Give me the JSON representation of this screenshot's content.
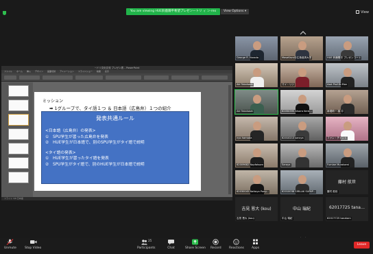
{
  "banner": "You are viewing HUE鈴鹿陽平希望プレゼン一トリ ィ ン-rex",
  "view_options": "View Options ▾",
  "view_label": "View",
  "ppt": {
    "title": "~ドリ文化交流 プレゼン表 – PowerPoint",
    "tabs": [
      "ファイル",
      "ホーム",
      "挿入",
      "デザイン",
      "画面切替",
      "アニメーション",
      "スライドショー",
      "校閲",
      "表示"
    ],
    "status": "スライド 3/8  日本語"
  },
  "slide": {
    "mission": "ミッション",
    "intro": "➡  1グループで、タイ語１つ ＆ 日本語（広島弁）１つの紹介",
    "rule_title": "発表共通ルール",
    "sec1_heading": "<日本語（広島弁）の発表>",
    "sec1_line1": "①　SPU学生が習った広島弁を発表",
    "sec1_line2": "②　HUE学生が日本語で、別のSPU学生がタイ語で説明",
    "sec2_heading": "<タイ語の発表>",
    "sec2_line1": "①　HUE学生が習ったタイ語を発表",
    "sec2_line2": "②　SPU学生がタイ語で、別のHUE学生が日本語で説明"
  },
  "participants": [
    {
      "name": "George R. Harada",
      "big": ""
    },
    {
      "name": "MasaKazu@広島経済大学",
      "big": ""
    },
    {
      "name": "HUE 鈴鹿陽平 プレゼンコート",
      "big": ""
    },
    {
      "name": "Aki Takahashi",
      "big": ""
    },
    {
      "name": "マイ・リジ",
      "big": ""
    },
    {
      "name": "Asst Prof.Dr.Mon",
      "big": ""
    },
    {
      "name": "Aki Takahashi",
      "big": ""
    },
    {
      "name": "62050395 Atsara Kerd…",
      "big": ""
    },
    {
      "name": "新堀莉一 橋 中",
      "big": ""
    },
    {
      "name": "nyo hamada",
      "big": ""
    },
    {
      "name": "62010213 saruya",
      "big": ""
    },
    {
      "name": "ファン・チャント",
      "big": ""
    },
    {
      "name": "62009682 Nopfatsorn",
      "big": ""
    },
    {
      "name": "Saraya",
      "big": ""
    },
    {
      "name": "Fumiae Murakami",
      "big": ""
    },
    {
      "name": "62030045 Nattaya Pong…",
      "big": ""
    },
    {
      "name": "62010038 SIRILAK SUPAP…",
      "big": ""
    },
    {
      "name": "藤村 航世",
      "big": "藤村 航世"
    },
    {
      "name": "吉見 恩大 (kou)",
      "big": "吉見 恩大 (kou)"
    },
    {
      "name": "中山 瑞紀",
      "big": "中山 瑞紀"
    },
    {
      "name": "62017725 tanatorn",
      "big": "62017725 tana…"
    }
  ],
  "toolbar": {
    "unmute": "Unmute",
    "stop_video": "Stop Video",
    "participants": "Participants",
    "participants_count": "25",
    "chat": "Chat",
    "share": "Share Screen",
    "record": "Record",
    "reactions": "Reactions",
    "apps": "Apps",
    "leave": "Leave"
  },
  "colors": {
    "banner": "#21b34a",
    "rule_box": "#4472c4",
    "leave": "#e02828",
    "share_icon": "#2fbf4f"
  }
}
